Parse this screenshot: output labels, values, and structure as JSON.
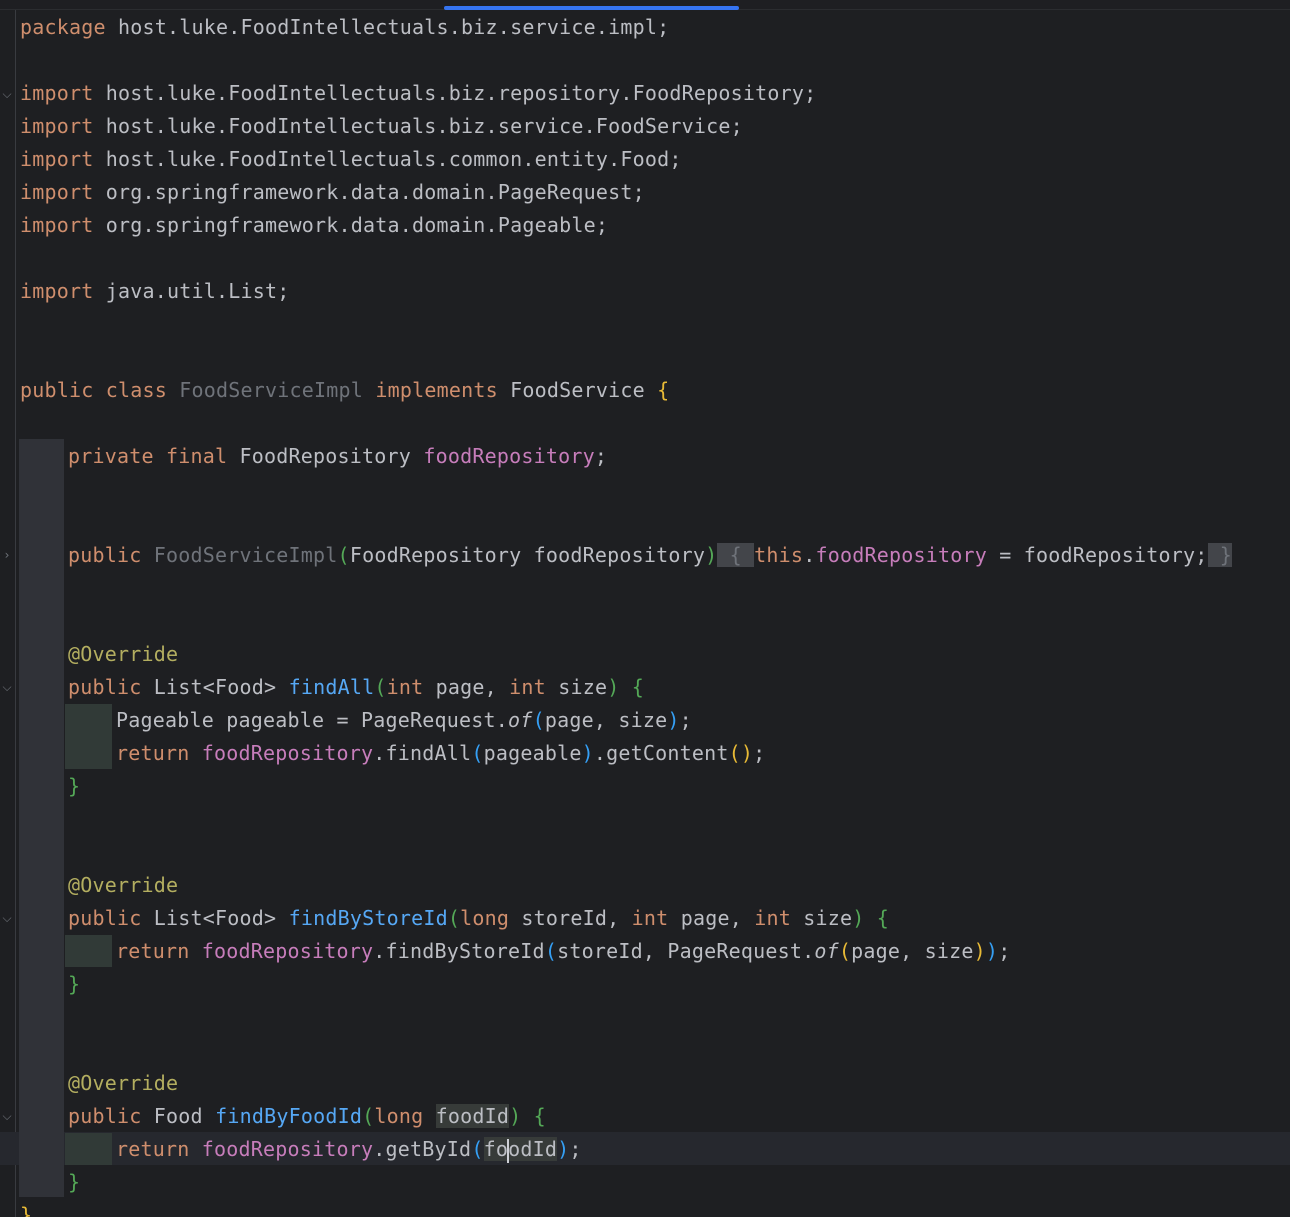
{
  "editor": {
    "lines": {
      "package": {
        "kw": "package",
        "name": "host.luke.FoodIntellectuals.biz.service.impl;"
      },
      "imports": [
        {
          "kw": "import",
          "path": "host.luke.FoodIntellectuals.biz.repository.FoodRepository;"
        },
        {
          "kw": "import",
          "path": "host.luke.FoodIntellectuals.biz.service.FoodService;"
        },
        {
          "kw": "import",
          "path": "host.luke.FoodIntellectuals.common.entity.Food;"
        },
        {
          "kw": "import",
          "path": "org.springframework.data.domain.PageRequest;"
        },
        {
          "kw": "import",
          "path": "org.springframework.data.domain.Pageable;"
        },
        {
          "kw": "import",
          "path": "java.util.List;"
        }
      ],
      "class_decl": {
        "mods": "public class",
        "name": "FoodServiceImpl",
        "implements": "implements",
        "iface": "FoodService",
        "open": "{"
      },
      "field": {
        "mods": "private final",
        "type": "FoodRepository",
        "name": "foodRepository",
        "end": ";"
      },
      "constructor": {
        "mods": "public",
        "name": "FoodServiceImpl",
        "lp": "(",
        "param_type": "FoodRepository",
        "param_name": "foodRepository",
        "rp": ")",
        "open": "{",
        "this": "this",
        "dot": ".",
        "field": "foodRepository",
        "assign": " = foodRepository;",
        "close": "}"
      },
      "method1": {
        "annotation": "@Override",
        "mods": "public",
        "ret": "List<Food>",
        "name": "findAll",
        "lp": "(",
        "t1": "int",
        "p1": "page,",
        "t2": "int",
        "p2": "size",
        "rp": ")",
        "open": "{",
        "body1_a": "Pageable pageable = PageRequest.",
        "body1_of": "of",
        "body1_lp": "(",
        "body1_args": "page, size",
        "body1_rp": ")",
        "body1_end": ";",
        "ret_kw": "return",
        "body2_field": "foodRepository",
        "body2_a": ".findAll",
        "body2_lp": "(",
        "body2_arg": "pageable",
        "body2_rp": ")",
        "body2_b": ".getContent",
        "body2_call": "()",
        "body2_end": ";",
        "close": "}"
      },
      "method2": {
        "annotation": "@Override",
        "mods": "public",
        "ret": "List<Food>",
        "name": "findByStoreId",
        "lp": "(",
        "t1": "long",
        "p1": "storeId,",
        "t2": "int",
        "p2": "page,",
        "t3": "int",
        "p3": "size",
        "rp": ")",
        "open": "{",
        "ret_kw": "return",
        "body_field": "foodRepository",
        "body_a": ".findByStoreId",
        "body_lp": "(",
        "body_b": "storeId, PageRequest.",
        "body_of": "of",
        "body_lp2": "(",
        "body_args": "page, size",
        "body_rp2": ")",
        "body_rp": ")",
        "body_end": ";",
        "close": "}"
      },
      "method3": {
        "annotation": "@Override",
        "mods": "public",
        "ret": "Food",
        "name": "findByFoodId",
        "lp": "(",
        "t1": "long",
        "p1": "foodId",
        "rp": ")",
        "open": "{",
        "ret_kw": "return",
        "body_field": "foodRepository",
        "body_a": ".getById",
        "body_lp": "(",
        "body_arg_pre": "fo",
        "body_arg_post": "odId",
        "body_rp": ")",
        "body_end": ";",
        "close": "}"
      },
      "class_close": "}"
    },
    "fold_markers": {
      "imports": "⌵",
      "constructor": "›",
      "method1": "⌵",
      "method2": "⌵",
      "method3": "⌵"
    },
    "colors": {
      "background": "#1e1f22",
      "keyword": "#cf8e6d",
      "field": "#c77dbb",
      "method": "#56a8f5",
      "annotation": "#b3ae60",
      "text": "#bcbec4",
      "unused": "#6f737a",
      "tab_indicator": "#3574f0"
    }
  }
}
